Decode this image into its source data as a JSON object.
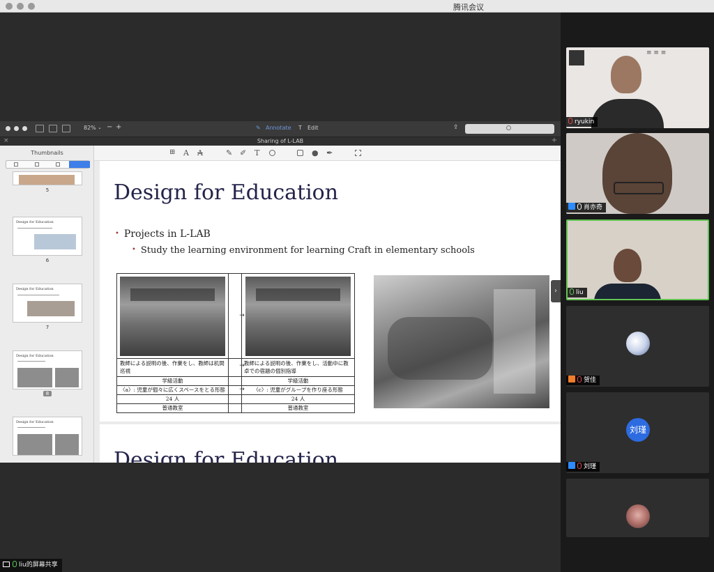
{
  "window": {
    "title": "腾讯会议"
  },
  "app": {
    "zoom": "82%",
    "annotate_label": "Annotate",
    "edit_label": "Edit",
    "document_title": "Sharing of L-LAB",
    "sidebar_title": "Thumbnails",
    "thumbnails": [
      {
        "page": "5",
        "title": ""
      },
      {
        "page": "6",
        "title": "Design for Education"
      },
      {
        "page": "7",
        "title": "Design for Education"
      },
      {
        "page": "8",
        "title": "Design for Education",
        "selected": true
      },
      {
        "page": "",
        "title": "Design for Education"
      }
    ]
  },
  "slide": {
    "title": "Design for Education",
    "bullet1": "Projects in L-LAB",
    "bullet2": "Study the learning environment for learning Craft in elementary schools",
    "table": {
      "left_desc": "教師による説明の後、作業をし、教師は机間巡視",
      "right_desc": "教師による説明の後、作業をし、活動中に教卓での宿題の個別指導",
      "left_activity": "学級活動",
      "right_activity": "学級活動",
      "left_form": "〈a〉: 児童が個々に広くスペースをとる形態",
      "right_form": "〈c〉: 児童がグループを作り座る形態",
      "left_count": "24 人",
      "right_count": "24 人",
      "left_room": "普通教室",
      "right_room": "普通教室",
      "arrow": "→"
    },
    "next_title": "Design for Education"
  },
  "participants": [
    {
      "name": "ryukin",
      "mic": "muted",
      "icon": "none"
    },
    {
      "name": "肖亦奇",
      "mic": "on",
      "icon": "blue"
    },
    {
      "name": "liu",
      "mic": "green",
      "icon": "none",
      "active": true
    },
    {
      "name": "贺佳",
      "mic": "muted",
      "icon": "orange"
    },
    {
      "name": "刘瑾",
      "mic": "muted",
      "icon": "blue",
      "avatar_text": "刘瑾"
    },
    {
      "name": "",
      "mic": "",
      "icon": "none"
    }
  ],
  "share_status": "liu的屏幕共享",
  "colors": {
    "accent": "#3d7ee8",
    "active_speaker": "#62c553",
    "avatar_blue": "#2d6be0"
  }
}
